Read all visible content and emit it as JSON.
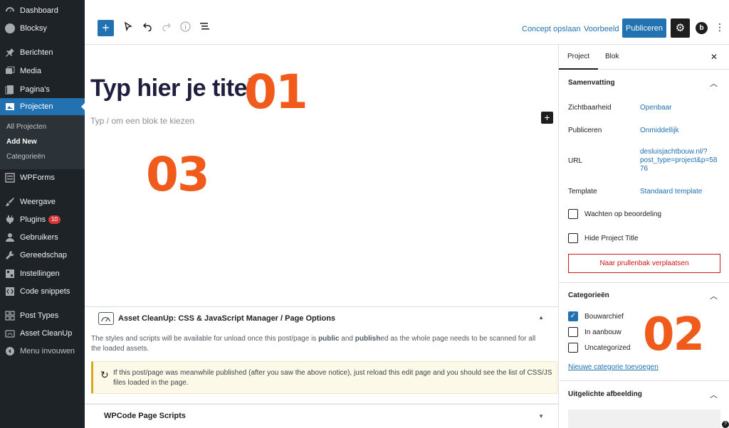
{
  "sidebar": {
    "items": [
      {
        "label": "Dashboard",
        "icon": "dashboard-icon"
      },
      {
        "label": "Blocksy",
        "icon": "blocksy-icon"
      },
      {
        "label": "Berichten",
        "icon": "pin-icon"
      },
      {
        "label": "Media",
        "icon": "media-icon"
      },
      {
        "label": "Pagina's",
        "icon": "page-icon"
      },
      {
        "label": "Projecten",
        "icon": "portfolio-icon"
      },
      {
        "label": "WPForms",
        "icon": "form-icon"
      },
      {
        "label": "Weergave",
        "icon": "brush-icon"
      },
      {
        "label": "Plugins",
        "icon": "plugin-icon",
        "badge": "10"
      },
      {
        "label": "Gebruikers",
        "icon": "users-icon"
      },
      {
        "label": "Gereedschap",
        "icon": "wrench-icon"
      },
      {
        "label": "Instellingen",
        "icon": "settings-icon"
      },
      {
        "label": "Code snippets",
        "icon": "code-icon"
      },
      {
        "label": "Post Types",
        "icon": "grid-icon"
      },
      {
        "label": "Asset CleanUp",
        "icon": "asset-icon"
      },
      {
        "label": "Menu invouwen",
        "icon": "collapse-icon"
      }
    ],
    "submenu": [
      "All Projecten",
      "Add New",
      "Categorieën"
    ]
  },
  "toolbar": {
    "save_draft": "Concept opslaan",
    "preview": "Voorbeeld",
    "publish": "Publiceren"
  },
  "editor": {
    "title": "Typ hier je titel",
    "placeholder": "Typ / om een blok te kiezen"
  },
  "annotations": {
    "a1": "01",
    "a2": "02",
    "a3": "03"
  },
  "metaboxes": {
    "asset_title": "Asset CleanUp: CSS & JavaScript Manager / Page Options",
    "asset_text_1": "The styles and scripts will be available for unload once this post/page is ",
    "asset_text_public": "public",
    "asset_text_and": " and ",
    "asset_text_published": "publish",
    "asset_text_ed": "ed",
    "asset_text_2": " as the whole page needs to be scanned for all the loaded assets.",
    "notice": "If this post/page was meanwhile published (after you saw the above notice), just reload this edit page and you should see the list of CSS/JS files loaded in the page.",
    "wpcode_title": "WPCode Page Scripts"
  },
  "settings": {
    "tab_project": "Project",
    "tab_block": "Blok",
    "summary_title": "Samenvatting",
    "visibility_label": "Zichtbaarheid",
    "visibility_value": "Openbaar",
    "publish_label": "Publiceren",
    "publish_value": "Onmiddellijk",
    "url_label": "URL",
    "url_value_1": "desluisjachtbouw.nl/?",
    "url_value_2": "post_type=project&p=58",
    "url_value_3": "76",
    "template_label": "Template",
    "template_value": "Standaard template",
    "pending_review": "Wachten op beoordeling",
    "hide_title": "Hide Project Title",
    "trash": "Naar prullenbak verplaatsen",
    "categories_title": "Categorieën",
    "categories": [
      {
        "label": "Bouwarchief",
        "checked": true
      },
      {
        "label": "In aanbouw",
        "checked": false
      },
      {
        "label": "Uncategorized",
        "checked": false
      }
    ],
    "new_category": "Nieuwe categorie toevoegen",
    "featured_title": "Uitgelichte afbeelding"
  },
  "colors": {
    "accent": "#2271b1",
    "admin_bg": "#1d2327",
    "annotation": "#f05a1a",
    "danger": "#cc1818"
  }
}
